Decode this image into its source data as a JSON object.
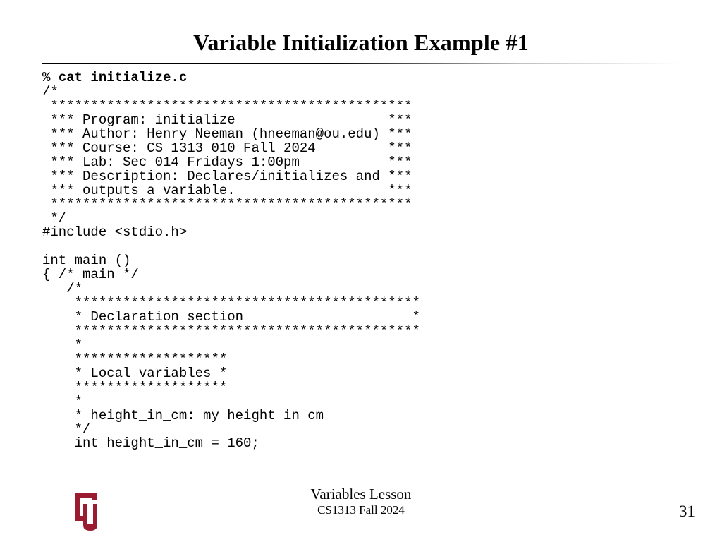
{
  "title": "Variable Initialization Example #1",
  "prompt": "% ",
  "command": "cat initialize.c",
  "code_body": "/*\n *********************************************\n *** Program: initialize                   ***\n *** Author: Henry Neeman (hneeman@ou.edu) ***\n *** Course: CS 1313 010 Fall 2024         ***\n *** Lab: Sec 014 Fridays 1:00pm           ***\n *** Description: Declares/initializes and ***\n *** outputs a variable.                   ***\n *********************************************\n */\n#include <stdio.h>\n\nint main ()\n{ /* main */\n   /*\n    *******************************************\n    * Declaration section                     *\n    *******************************************\n    *\n    *******************\n    * Local variables *\n    *******************\n    *\n    * height_in_cm: my height in cm\n    */\n    int height_in_cm = 160;",
  "footer": {
    "lesson": "Variables Lesson",
    "course": "CS1313 Fall 2024",
    "page": "31"
  },
  "colors": {
    "logo": "#9b1b30"
  }
}
